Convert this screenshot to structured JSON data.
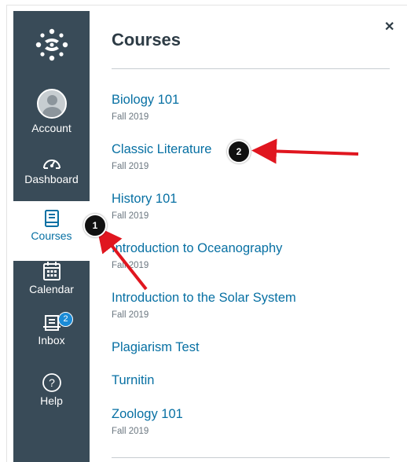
{
  "nav": {
    "items": [
      {
        "label": "Account"
      },
      {
        "label": "Dashboard"
      },
      {
        "label": "Courses"
      },
      {
        "label": "Calendar"
      },
      {
        "label": "Inbox",
        "badge": "2"
      },
      {
        "label": "Help"
      }
    ]
  },
  "tray": {
    "title": "Courses",
    "close_icon": "close-icon",
    "courses": [
      {
        "name": "Biology 101",
        "term": "Fall 2019"
      },
      {
        "name": "Classic Literature",
        "term": "Fall 2019"
      },
      {
        "name": "History 101",
        "term": "Fall 2019"
      },
      {
        "name": "Introduction to Oceanography",
        "term": "Fall 2019"
      },
      {
        "name": "Introduction to the Solar System",
        "term": "Fall 2019"
      },
      {
        "name": "Plagiarism Test"
      },
      {
        "name": "Turnitin"
      },
      {
        "name": "Zoology 101",
        "term": "Fall 2019"
      }
    ]
  },
  "annotations": {
    "callout_1": "1",
    "callout_2": "2"
  },
  "colors": {
    "nav_bg": "#394b58",
    "link": "#0770a3",
    "arrow": "#e0161f",
    "badge": "#1b8bd6"
  }
}
